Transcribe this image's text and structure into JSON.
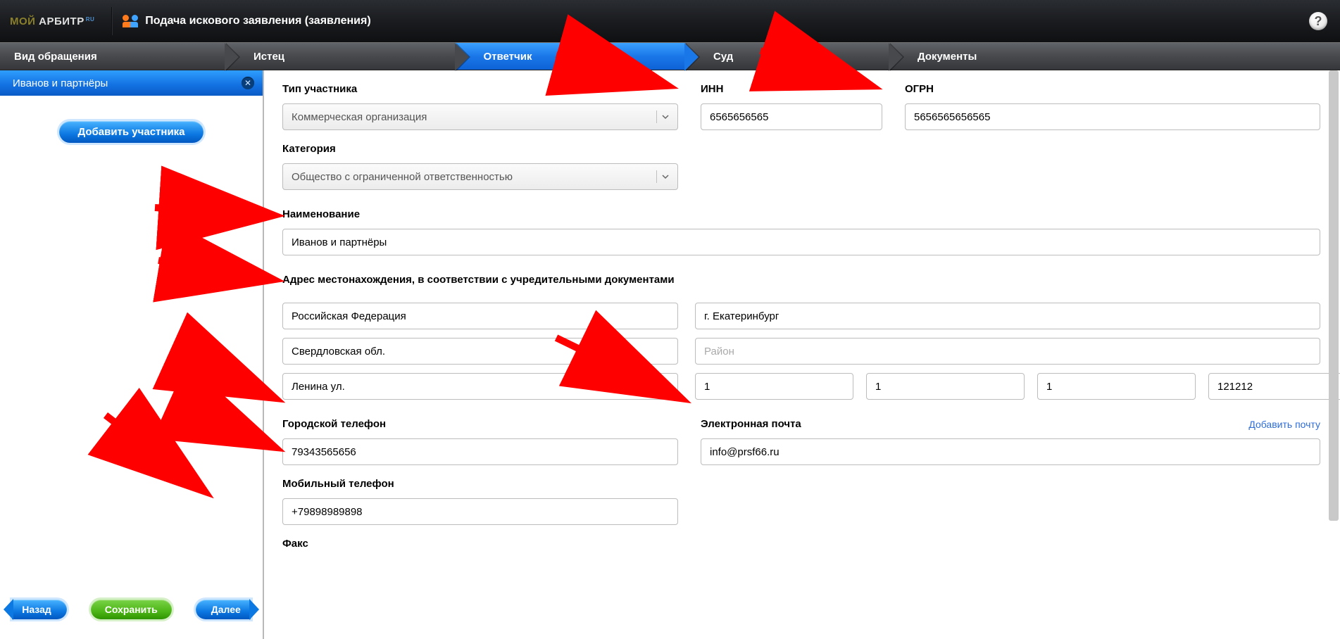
{
  "header": {
    "brand_part1": "МОЙ",
    "brand_part2": "АРБИТР",
    "brand_ru": "RU",
    "title": "Подача искового заявления (заявления)",
    "help": "?"
  },
  "steps": {
    "s1": "Вид обращения",
    "s2": "Истец",
    "s3": "Ответчик",
    "s4": "Суд",
    "s5": "Документы"
  },
  "sidebar": {
    "participant": "Иванов и партнёры",
    "add_btn": "Добавить участника",
    "back": "Назад",
    "save": "Сохранить",
    "next": "Далее"
  },
  "form": {
    "type_label": "Тип участника",
    "type_value": "Коммерческая организация",
    "inn_label": "ИНН",
    "inn_value": "6565656565",
    "ogrn_label": "ОГРН",
    "ogrn_value": "5656565656565",
    "category_label": "Категория",
    "category_value": "Общество с ограниченной ответственностью",
    "name_label": "Наименование",
    "name_value": "Иванов и партнёры",
    "address_label": "Адрес местонахождения, в соответствии с учредительными документами",
    "country": "Российская Федерация",
    "city": "г. Екатеринбург",
    "region": "Свердловская обл.",
    "district_placeholder": "Район",
    "street": "Ленина ул.",
    "house": "1",
    "building": "1",
    "flat": "1",
    "postcode": "121212",
    "phone_city_label": "Городской телефон",
    "phone_city_value": "79343565656",
    "email_label": "Электронная почта",
    "email_add_link": "Добавить почту",
    "email_value": "info@prsf66.ru",
    "phone_mobile_label": "Мобильный телефон",
    "phone_mobile_value": "+79898989898",
    "fax_label": "Факс"
  }
}
